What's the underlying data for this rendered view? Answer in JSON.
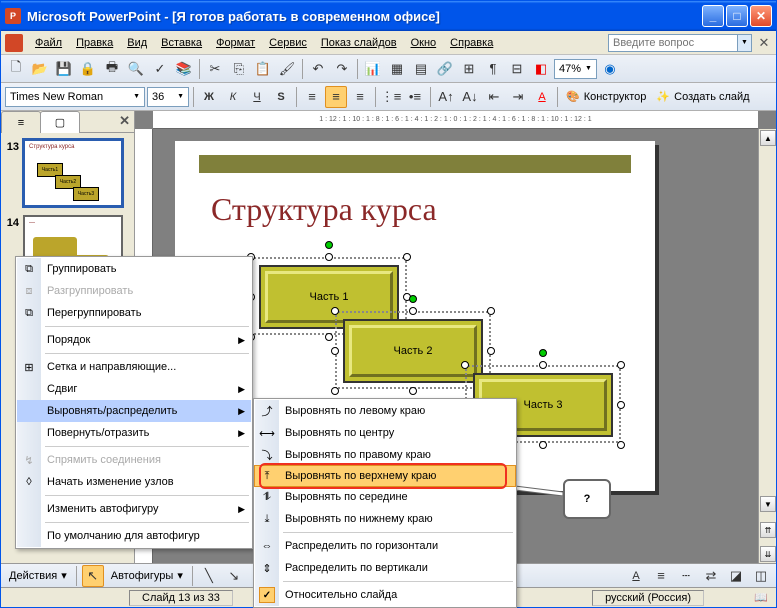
{
  "window": {
    "title": "Microsoft PowerPoint - [Я готов работать в современном офисе]"
  },
  "menu": {
    "items": [
      "Файл",
      "Правка",
      "Вид",
      "Вставка",
      "Формат",
      "Сервис",
      "Показ слайдов",
      "Окно",
      "Справка"
    ],
    "ask_placeholder": "Введите вопрос"
  },
  "toolbar1": {
    "zoom": "47%"
  },
  "toolbar2": {
    "font": "Times New Roman",
    "size": "36",
    "designer": "Конструктор",
    "new_slide": "Создать слайд"
  },
  "ruler": "1 : 12 : 1 : 10 : 1 : 8 : 1 : 6 : 1 : 4 : 1 : 2 : 1 : 0 : 1 : 2 : 1 : 4 : 1 : 6 : 1 : 8 : 1 : 10 : 1 : 12 : 1",
  "thumbs": {
    "n1": "13",
    "n2": "14",
    "t1": "Структура курса"
  },
  "slide": {
    "title": "Структура курса",
    "s1": "Часть 1",
    "s2": "Часть 2",
    "s3": "Часть 3"
  },
  "cm1": {
    "group": "Группировать",
    "ungroup": "Разгруппировать",
    "regroup": "Перегруппировать",
    "order": "Порядок",
    "grid": "Сетка и направляющие...",
    "nudge": "Сдвиг",
    "align": "Выровнять/распределить",
    "rotate": "Повернуть/отразить",
    "reroute": "Спрямить соединения",
    "edit_points": "Начать изменение узлов",
    "change_shape": "Изменить автофигуру",
    "defaults": "По умолчанию для автофигур"
  },
  "cm2": {
    "left": "Выровнять по левому краю",
    "center_h": "Выровнять по центру",
    "right": "Выровнять по правому краю",
    "top": "Выровнять по верхнему краю",
    "middle": "Выровнять по середине",
    "bottom": "Выровнять по нижнему краю",
    "dist_h": "Распределить по горизонтали",
    "dist_v": "Распределить по вертикали",
    "rel": "Относительно слайда"
  },
  "callout": {
    "q": "?"
  },
  "bottom": {
    "actions": "Действия",
    "autoshapes": "Автофигуры"
  },
  "status": {
    "slide": "Слайд 13 из 33",
    "lang": "русский (Россия)"
  }
}
